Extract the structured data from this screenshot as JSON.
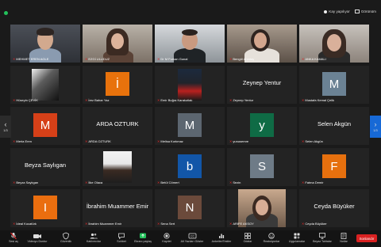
{
  "topbar": {
    "view_label": "Görünüm",
    "recording_label": "Kay yapılıyor"
  },
  "pager": {
    "left_page": "1/3",
    "right_page": "1/3"
  },
  "tiles": [
    {
      "name": "MEHMET EREN AGLE"
    },
    {
      "name": "EZGİ ULUDUZ"
    },
    {
      "name": "Dr M Furkan Gunal"
    },
    {
      "name": "Bengül Ahmtay"
    },
    {
      "name": "ANKA KAMALI"
    },
    {
      "name": "Hüseyin ÇEVİK"
    },
    {
      "name": "İrez Bahar Yaz",
      "letter": "İ",
      "color": "#e8720c"
    },
    {
      "name": "Emir Buğra Karakutlak"
    },
    {
      "name": "Zeynep Yentur",
      "big": "Zeynep Yentur"
    },
    {
      "name": "Mustafa Kemal Çelik",
      "letter": "M",
      "color": "#6b8294"
    },
    {
      "name": "Merla Eren",
      "letter": "M",
      "color": "#d64018"
    },
    {
      "name": "ARDA OZTURK",
      "big": "ARDA OZTURK"
    },
    {
      "name": "Melisa Korkmaz",
      "letter": "M",
      "color": "#5c6670"
    },
    {
      "name": "yunusemre",
      "letter": "y",
      "color": "#0f6b45"
    },
    {
      "name": "Selen Akgün",
      "big": "Selen Akgün"
    },
    {
      "name": "Beyza Saylıgan",
      "big": "Beyza Saylıgan"
    },
    {
      "name": "İlke Olaca"
    },
    {
      "name": "Betül Cömert",
      "letter": "b",
      "color": "#1256a8"
    },
    {
      "name": "Sezin",
      "letter": "S",
      "color": "#6e7b87"
    },
    {
      "name": "Fatma Demir",
      "letter": "F",
      "color": "#e6700e"
    },
    {
      "name": "İdeal Kocatürk",
      "letter": "I",
      "color": "#ea6e0f"
    },
    {
      "name": "İbrahim Muammer Emir",
      "big": "İbrahim Muammer Emir"
    },
    {
      "name": "Sena Sert",
      "letter": "N",
      "color": "#6b4a3b"
    },
    {
      "name": "ARIFE AKSOY"
    },
    {
      "name": "Ceyda Büyüker",
      "big": "Ceyda Büyüker"
    }
  ],
  "toolbar": {
    "items": [
      {
        "label": "Sesi aç",
        "icon": "mic-muted-icon"
      },
      {
        "label": "Videoyu Durdur",
        "icon": "video-icon"
      },
      {
        "label": "Güvenlik",
        "icon": "shield-icon"
      },
      {
        "label": "Katılımcılar",
        "icon": "participants-icon"
      },
      {
        "label": "Sohbet",
        "icon": "chat-icon"
      },
      {
        "label": "Ekranı paylaş",
        "icon": "share-screen-icon"
      },
      {
        "label": "Kaydet",
        "icon": "record-icon"
      },
      {
        "label": "Alt Yazıları Göster",
        "icon": "cc-icon"
      },
      {
        "label": "Anketler/Testler",
        "icon": "poll-icon"
      },
      {
        "label": "Odalar",
        "icon": "rooms-icon"
      },
      {
        "label": "Reaksiyonlar",
        "icon": "reactions-icon"
      },
      {
        "label": "Uygulamalar",
        "icon": "apps-icon"
      },
      {
        "label": "Beyaz Tahtalar",
        "icon": "whiteboard-icon"
      },
      {
        "label": "Notlar",
        "icon": "notes-icon"
      }
    ],
    "end_label": "Sonlandır"
  }
}
